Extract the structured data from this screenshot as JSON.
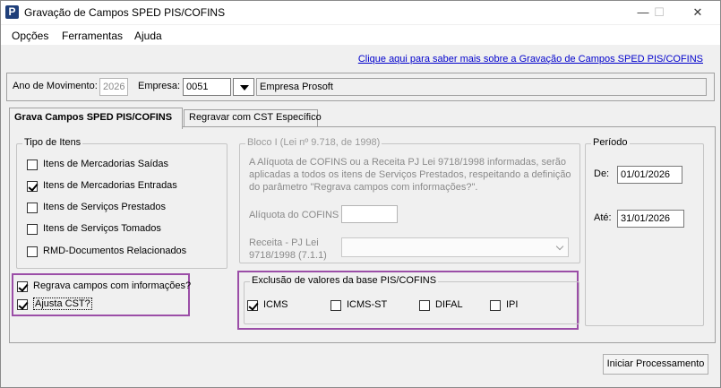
{
  "window": {
    "title": "Gravação de Campos SPED PIS/COFINS",
    "icon_letter": "P",
    "minimize": "—",
    "maximize": "☐",
    "close": "✕"
  },
  "menu": [
    "Opções",
    "Ferramentas",
    "Ajuda"
  ],
  "help_link": "Clique aqui para saber mais sobre a Gravação de Campos SPED PIS/COFINS",
  "header": {
    "ano_label": "Ano de Movimento:",
    "ano_value": "2026",
    "empresa_label": "Empresa:",
    "empresa_code": "0051",
    "empresa_name": "Empresa Prosoft"
  },
  "tabs": [
    {
      "label": "Grava Campos SPED PIS/COFINS",
      "active": true
    },
    {
      "label": "Regravar com CST Específico",
      "active": false
    }
  ],
  "tipo_itens": {
    "title": "Tipo de Itens",
    "items": [
      {
        "label": "Itens de Mercadorias Saídas",
        "checked": false
      },
      {
        "label": "Itens de Mercadorias Entradas",
        "checked": true
      },
      {
        "label": "Itens de Serviços Prestados",
        "checked": false
      },
      {
        "label": "Itens de Serviços Tomados",
        "checked": false
      },
      {
        "label": "RMD-Documentos Relacionados",
        "checked": false
      }
    ]
  },
  "options": [
    {
      "label": "Regrava campos com informações?",
      "checked": true
    },
    {
      "label": "Ajusta CST?",
      "checked": true
    }
  ],
  "bloco_i": {
    "title": "Bloco I (Lei nº 9.718, de 1998)",
    "description": "A Alíquota de COFINS ou a Receita PJ Lei 9718/1998 informadas, serão aplicadas a todos os itens de Serviços Prestados, respeitando a definição do parâmetro \"Regrava campos com informações?\".",
    "aliquota_label": "Alíquota do COFINS",
    "aliquota_value": "",
    "receita_label_1": "Receita - PJ Lei",
    "receita_label_2": "9718/1998 (7.1.1)",
    "receita_value": ""
  },
  "exclusao": {
    "title": "Exclusão de valores da base PIS/COFINS",
    "items": [
      {
        "label": "ICMS",
        "checked": true
      },
      {
        "label": "ICMS-ST",
        "checked": false
      },
      {
        "label": "DIFAL",
        "checked": false
      },
      {
        "label": "IPI",
        "checked": false
      }
    ]
  },
  "periodo": {
    "title": "Período",
    "de_label": "De:",
    "de_value": "01/01/2026",
    "ate_label": "Até:",
    "ate_value": "31/01/2026"
  },
  "iniciar_button": "Iniciar Processamento",
  "colors": {
    "highlight": "#9b4ea7",
    "link": "#0000cc"
  }
}
